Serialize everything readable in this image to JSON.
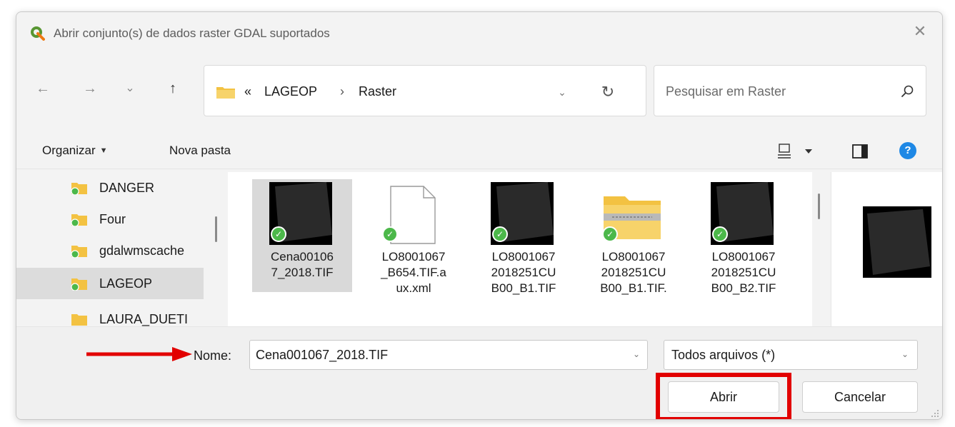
{
  "window": {
    "title": "Abrir conjunto(s) de dados raster GDAL suportados",
    "close_symbol": "✕"
  },
  "navigation": {
    "back_symbol": "←",
    "forward_symbol": "→",
    "recent_symbol": "⌄",
    "up_symbol": "↑",
    "breadcrumb_prefix": "«",
    "breadcrumb": [
      "LAGEOP",
      "Raster"
    ],
    "breadcrumb_separator": "›",
    "dropdown_symbol": "⌄",
    "refresh_symbol": "↻"
  },
  "search": {
    "placeholder": "Pesquisar em Raster",
    "icon": "search-icon"
  },
  "toolbar": {
    "organize_label": "Organizar",
    "organize_caret": "▼",
    "new_folder_label": "Nova pasta",
    "help_label": "?"
  },
  "sidebar": {
    "items": [
      {
        "label": "DANGER",
        "selected": false
      },
      {
        "label": "Four",
        "selected": false
      },
      {
        "label": "gdalwmscache",
        "selected": false
      },
      {
        "label": "LAGEOP",
        "selected": true
      },
      {
        "label": "LAURA_DUETI",
        "selected": false
      }
    ]
  },
  "files": [
    {
      "name": "Cena001067_2018.TIF",
      "lines": [
        "Cena00106",
        "7_2018.TIF"
      ],
      "kind": "raster",
      "selected": true
    },
    {
      "name": "LO8001067_B654.TIF.aux.xml",
      "lines": [
        "LO8001067",
        "_B654.TIF.a",
        "ux.xml"
      ],
      "kind": "document",
      "selected": false
    },
    {
      "name": "LO80010672018251CUB00_B1.TIF",
      "lines": [
        "LO8001067",
        "2018251CU",
        "B00_B1.TIF"
      ],
      "kind": "raster",
      "selected": false
    },
    {
      "name": "LO80010672018251CUB00_B1.TIF.",
      "lines": [
        "LO8001067",
        "2018251CU",
        "B00_B1.TIF."
      ],
      "kind": "zip-folder",
      "selected": false
    },
    {
      "name": "LO80010672018251CUB00_B2.TIF",
      "lines": [
        "LO8001067",
        "2018251CU",
        "B00_B2.TIF"
      ],
      "kind": "raster",
      "selected": false
    }
  ],
  "footer": {
    "name_label": "Nome:",
    "name_value": "Cena001067_2018.TIF",
    "type_value": "Todos arquivos (*)",
    "open_label": "Abrir",
    "cancel_label": "Cancelar"
  },
  "colors": {
    "annotation_red": "#e20000",
    "sync_check_green": "#4cb84a",
    "help_blue": "#1e88e5",
    "folder_yellow": "#f3c242"
  }
}
